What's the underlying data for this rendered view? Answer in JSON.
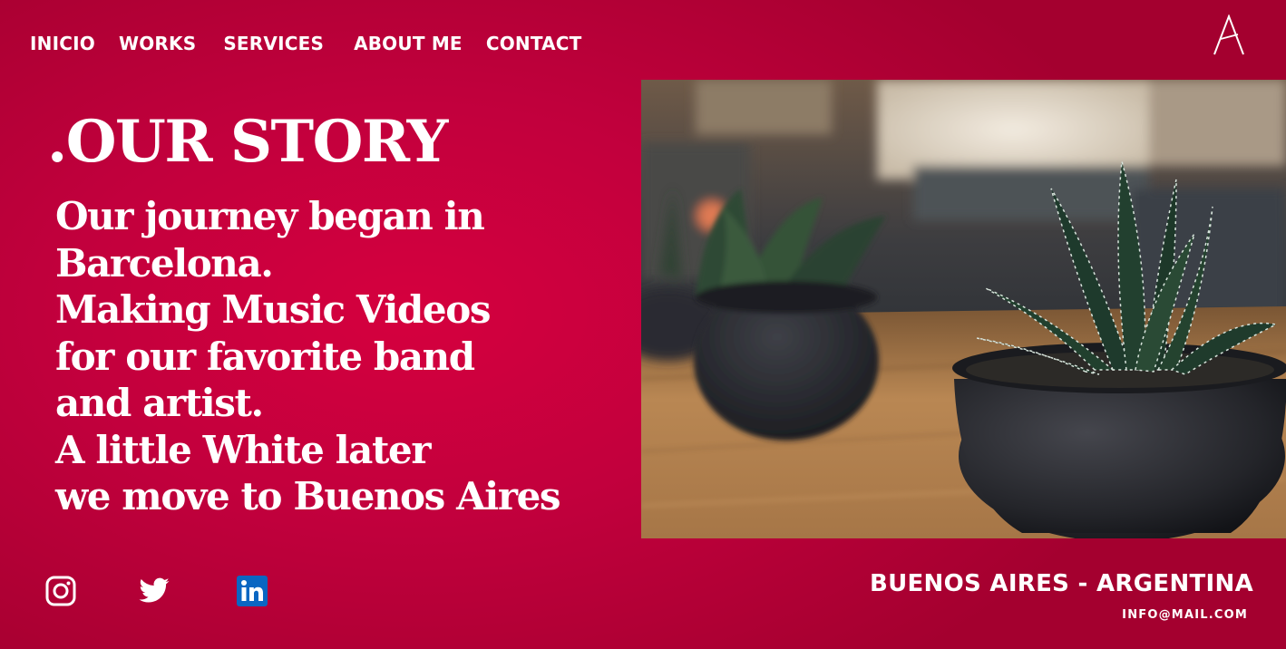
{
  "nav": {
    "items": [
      {
        "label": "INICIO"
      },
      {
        "label": "WORKS"
      },
      {
        "label": "SERVICES"
      },
      {
        "label": "ABOUT ME"
      },
      {
        "label": "CONTACT"
      }
    ]
  },
  "logo": {
    "letter": "A",
    "icon": "a-logo-icon"
  },
  "hero": {
    "title": ".OUR STORY",
    "lines": [
      "Our journey began in",
      "Barcelona.",
      "Making Music Videos",
      "for our favorite band",
      "and artist.",
      "A little White later",
      "we move to Buenos Aires"
    ]
  },
  "photo": {
    "subject": "potted succulent plants on wooden table",
    "icon": "plant-photo"
  },
  "social": [
    {
      "icon": "instagram-icon"
    },
    {
      "icon": "twitter-icon"
    },
    {
      "icon": "linkedin-icon",
      "brand_color": "#0a66c2"
    }
  ],
  "footer": {
    "location": "BUENOS AIRES - ARGENTINA",
    "email": "INFO@MAIL.COM"
  },
  "colors": {
    "background_center": "#d5003e",
    "background_edge": "#a4002f",
    "text": "#ffffff"
  }
}
